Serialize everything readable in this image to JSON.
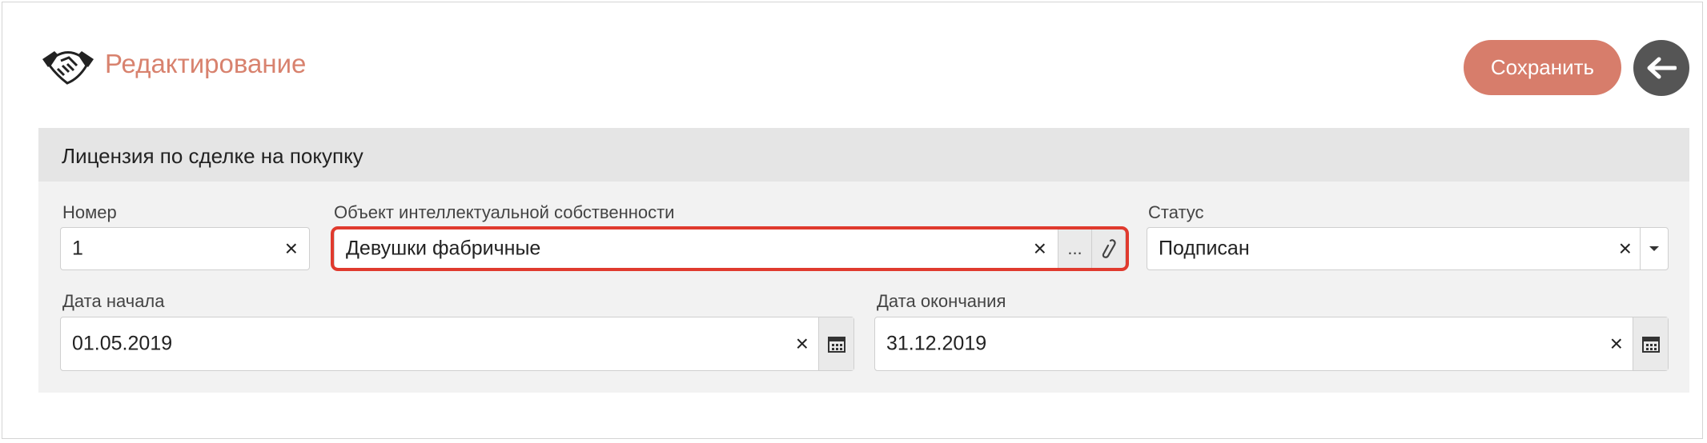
{
  "header": {
    "title": "Редактирование",
    "save_label": "Сохранить"
  },
  "section": {
    "title": "Лицензия по сделке на покупку"
  },
  "fields": {
    "number": {
      "label": "Номер",
      "value": "1"
    },
    "object": {
      "label": "Объект интеллектуальной собственности",
      "value": "Девушки фабричные",
      "dots": "..."
    },
    "status": {
      "label": "Статус",
      "value": "Подписан"
    },
    "start_date": {
      "label": "Дата начала",
      "value": "01.05.2019"
    },
    "end_date": {
      "label": "Дата окончания",
      "value": "31.12.2019"
    }
  },
  "icons": {
    "clear": "×",
    "close_glyph": "✕"
  },
  "colors": {
    "accent": "#d77d6b",
    "title": "#d8826e",
    "highlight": "#e03a2e",
    "back_button": "#555555"
  }
}
